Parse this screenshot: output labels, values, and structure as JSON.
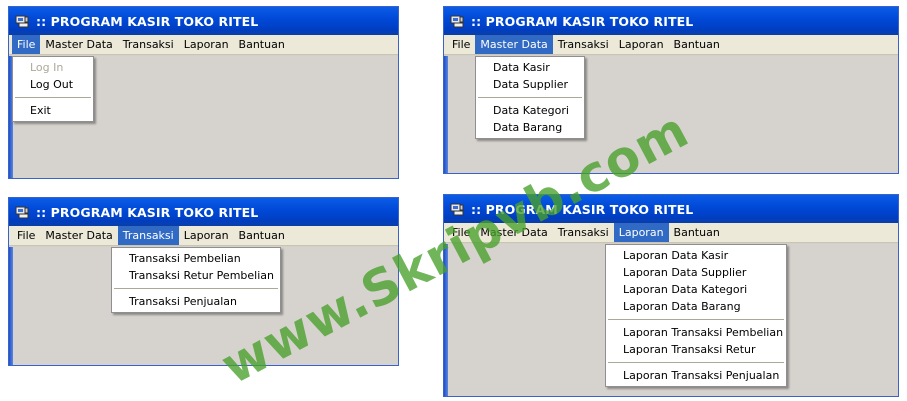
{
  "title": ":: PROGRAM KASIR TOKO RITEL",
  "menu": [
    "File",
    "Master Data",
    "Transaksi",
    "Laporan",
    "Bantuan"
  ],
  "windows": [
    {
      "active": 0,
      "items": [
        {
          "label": "Log In",
          "disabled": true
        },
        {
          "label": "Log Out"
        },
        {
          "sep": true
        },
        {
          "label": "Exit"
        }
      ]
    },
    {
      "active": 1,
      "items": [
        {
          "label": "Data Kasir"
        },
        {
          "label": "Data Supplier"
        },
        {
          "sep": true
        },
        {
          "label": "Data Kategori"
        },
        {
          "label": "Data Barang"
        }
      ]
    },
    {
      "active": 2,
      "items": [
        {
          "label": "Transaksi Pembelian"
        },
        {
          "label": "Transaksi Retur Pembelian"
        },
        {
          "sep": true
        },
        {
          "label": "Transaksi Penjualan"
        }
      ]
    },
    {
      "active": 3,
      "items": [
        {
          "label": "Laporan Data Kasir"
        },
        {
          "label": "Laporan Data Supplier"
        },
        {
          "label": "Laporan Data Kategori"
        },
        {
          "label": "Laporan Data Barang"
        },
        {
          "sep": true
        },
        {
          "label": "Laporan Transaksi Pembelian"
        },
        {
          "label": "Laporan Transaksi Retur"
        },
        {
          "sep": true
        },
        {
          "label": "Laporan Transaksi Penjualan"
        }
      ]
    }
  ],
  "watermark": "www.Skripvb.com",
  "colors": {
    "titlebar": "#0054e3",
    "menu_highlight": "#316ac5",
    "client": "#d6d3ce",
    "watermark": "#48a02a"
  }
}
